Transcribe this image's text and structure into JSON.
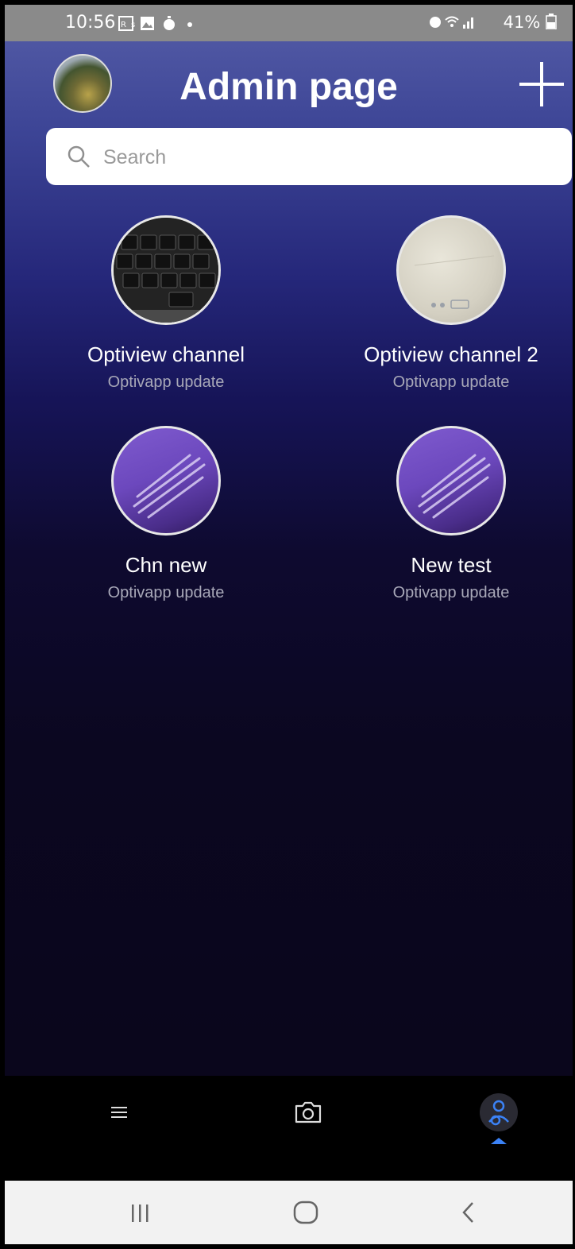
{
  "status_bar": {
    "time": "10:56",
    "battery": "41%"
  },
  "header": {
    "title": "Admin page"
  },
  "search": {
    "placeholder": "Search"
  },
  "channels": [
    {
      "name": "Optiview channel",
      "subtitle": "Optivapp update",
      "thumbnail": "keyboard-photo"
    },
    {
      "name": "Optiview channel 2",
      "subtitle": "Optivapp update",
      "thumbnail": "paper-photo"
    },
    {
      "name": "Chn new",
      "subtitle": "Optivapp update",
      "thumbnail": "purple-lines"
    },
    {
      "name": "New test",
      "subtitle": "Optivapp update",
      "thumbnail": "purple-lines"
    }
  ],
  "tab_bar": {
    "items": [
      "menu-icon",
      "camera-icon",
      "admin-icon"
    ],
    "active": "admin-icon"
  },
  "colors": {
    "accent": "#3b82f6",
    "header_top": "#565ea8",
    "background_bottom": "#0a061c"
  }
}
